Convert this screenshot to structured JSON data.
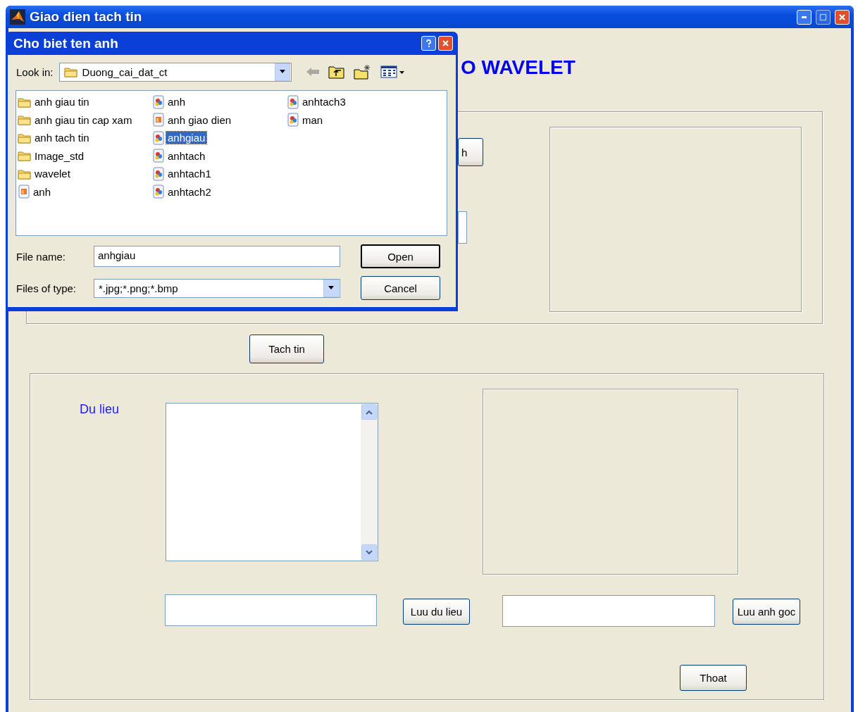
{
  "window": {
    "title": "Giao dien tach tin"
  },
  "heading": "O WAVELET",
  "partial_button": "h",
  "extract_button": "Tach tin",
  "lower_panel": {
    "label": "Du lieu",
    "save_data_button": "Luu du lieu",
    "save_image_button": "Luu anh goc",
    "exit_button": "Thoat"
  },
  "dialog": {
    "title": "Cho biet ten anh",
    "look_in_label": "Look in:",
    "look_in_value": "Duong_cai_dat_ct",
    "files": [
      {
        "name": "anh giau tin",
        "kind": "folder",
        "selected": false
      },
      {
        "name": "anh giau tin cap xam",
        "kind": "folder",
        "selected": false
      },
      {
        "name": "anh tach tin",
        "kind": "folder",
        "selected": false
      },
      {
        "name": "Image_std",
        "kind": "folder",
        "selected": false
      },
      {
        "name": "wavelet",
        "kind": "folder",
        "selected": false
      },
      {
        "name": "anh",
        "kind": "photo",
        "selected": false
      },
      {
        "name": "anh",
        "kind": "image",
        "selected": false
      },
      {
        "name": "anh giao dien",
        "kind": "photo",
        "selected": false
      },
      {
        "name": "anhgiau",
        "kind": "image",
        "selected": true
      },
      {
        "name": "anhtach",
        "kind": "image",
        "selected": false
      },
      {
        "name": "anhtach1",
        "kind": "image",
        "selected": false
      },
      {
        "name": "anhtach2",
        "kind": "image",
        "selected": false
      },
      {
        "name": "anhtach3",
        "kind": "image",
        "selected": false
      },
      {
        "name": "man",
        "kind": "image",
        "selected": false
      }
    ],
    "file_name_label": "File name:",
    "file_name_value": "anhgiau",
    "file_type_label": "Files of type:",
    "file_type_value": "*.jpg;*.png;*.bmp",
    "buttons": [
      "Open",
      "Cancel"
    ]
  }
}
